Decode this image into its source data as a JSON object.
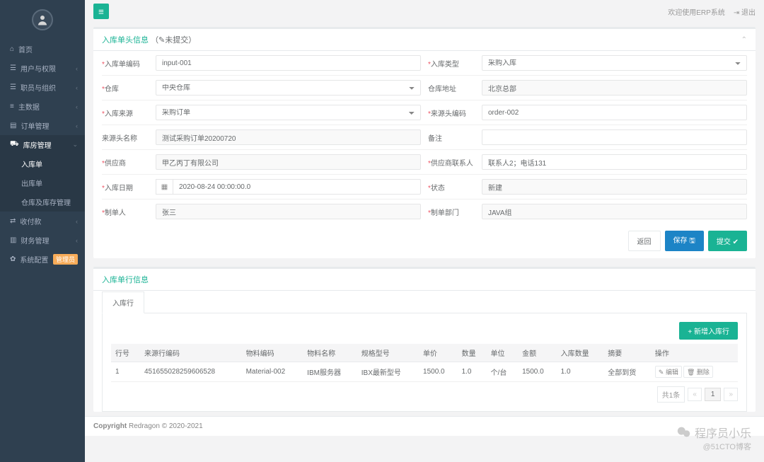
{
  "topbar": {
    "welcome": "欢迎使用ERP系统",
    "logout": "退出"
  },
  "sidebar": {
    "items": [
      {
        "icon": "home",
        "label": "首页"
      },
      {
        "icon": "users",
        "label": "用户与权限",
        "caret": true
      },
      {
        "icon": "org",
        "label": "职员与组织",
        "caret": true
      },
      {
        "icon": "data",
        "label": "主数据",
        "caret": true
      },
      {
        "icon": "order",
        "label": "订单管理",
        "caret": true
      },
      {
        "icon": "warehouse",
        "label": "库房管理",
        "caret": true,
        "active": true,
        "sub": [
          {
            "label": "入库单",
            "active": true
          },
          {
            "label": "出库单"
          },
          {
            "label": "仓库及库存管理"
          }
        ]
      },
      {
        "icon": "pay",
        "label": "收付款",
        "caret": true
      },
      {
        "icon": "finance",
        "label": "财务管理",
        "caret": true
      },
      {
        "icon": "config",
        "label": "系统配置",
        "badge": "管理员"
      }
    ]
  },
  "panel1": {
    "title": "入库单头信息",
    "status": "（✎未提交）"
  },
  "form": {
    "code_label": "入库单编码",
    "code_value": "input-001",
    "type_label": "入库类型",
    "type_value": "采购入库",
    "wh_label": "仓库",
    "wh_value": "中央仓库",
    "addr_label": "仓库地址",
    "addr_value": "北京总部",
    "src_label": "入库来源",
    "src_value": "采购订单",
    "srccode_label": "来源头编码",
    "srccode_value": "order-002",
    "srcname_label": "来源头名称",
    "srcname_value": "测试采购订单20200720",
    "remark_label": "备注",
    "remark_value": "",
    "supplier_label": "供应商",
    "supplier_value": "甲乙丙丁有限公司",
    "contact_label": "供应商联系人",
    "contact_value": "联系人2；电话131",
    "date_label": "入库日期",
    "date_value": "2020-08-24 00:00:00.0",
    "status_label": "状态",
    "status_value": "新建",
    "maker_label": "制单人",
    "maker_value": "张三",
    "dept_label": "制单部门",
    "dept_value": "JAVA组"
  },
  "buttons": {
    "back": "返回",
    "save": "保存",
    "submit": "提交"
  },
  "panel2": {
    "title": "入库单行信息",
    "tab": "入库行",
    "add": "新增入库行"
  },
  "table": {
    "headers": [
      "行号",
      "来源行编码",
      "物料编码",
      "物料名称",
      "规格型号",
      "单价",
      "数量",
      "单位",
      "金额",
      "入库数量",
      "摘要",
      "操作"
    ],
    "rows": [
      {
        "no": "1",
        "srccode": "451655028259606528",
        "mat": "Material-002",
        "matname": "IBM服务器",
        "spec": "IBX最新型号",
        "price": "1500.0",
        "qty": "1.0",
        "unit": "个/台",
        "amount": "1500.0",
        "inqty": "1.0",
        "summary": "全部到货"
      }
    ],
    "op_edit": "编辑",
    "op_del": "删除",
    "page_info": "共1条",
    "page_num": "1"
  },
  "footer": {
    "copy": "Copyright",
    "text": " Redragon © 2020-2021"
  },
  "watermark": {
    "text": "程序员小乐",
    "sub": "@51CTO博客"
  }
}
